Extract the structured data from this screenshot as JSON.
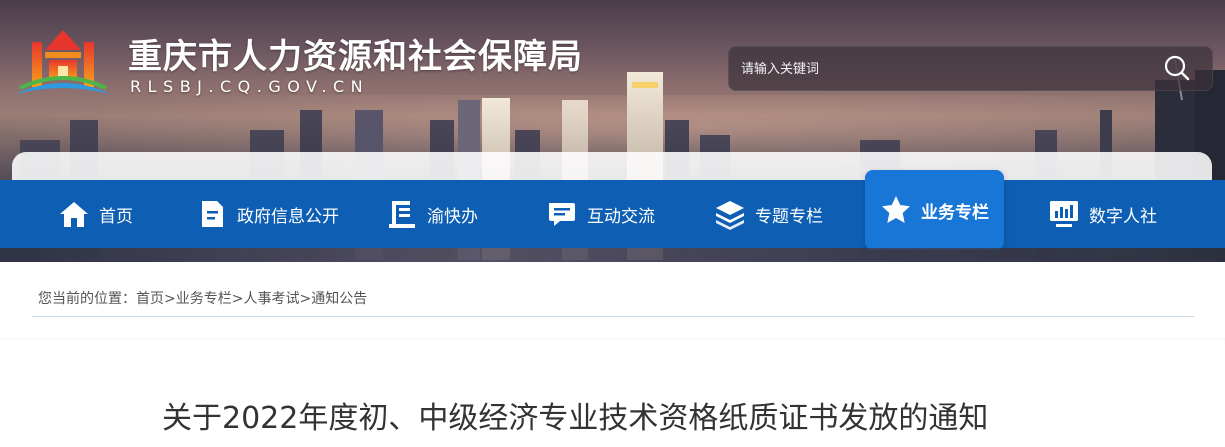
{
  "header": {
    "title": "重庆市人力资源和社会保障局",
    "domain": "RLSBJ.CQ.GOV.CN",
    "logo": "government-emblem-logo"
  },
  "search": {
    "placeholder": "请输入关键词",
    "button_icon": "search-icon"
  },
  "nav": {
    "items": [
      {
        "label": "首页",
        "icon": "home-icon"
      },
      {
        "label": "政府信息公开",
        "icon": "document-icon"
      },
      {
        "label": "渝快办",
        "icon": "service-icon"
      },
      {
        "label": "互动交流",
        "icon": "chat-icon"
      },
      {
        "label": "专题专栏",
        "icon": "layers-icon"
      },
      {
        "label": "业务专栏",
        "icon": "star-icon",
        "active": true
      },
      {
        "label": "数字人社",
        "icon": "monitor-icon"
      }
    ],
    "active_color": "#1876d6",
    "bar_color": "#0e5fb4"
  },
  "breadcrumb": {
    "prefix": "您当前的位置：",
    "items": [
      "首页",
      "业务专栏",
      "人事考试",
      "通知公告"
    ],
    "separator": ">"
  },
  "article": {
    "title": "关于2022年度初、中级经济专业技术资格纸质证书发放的通知"
  }
}
